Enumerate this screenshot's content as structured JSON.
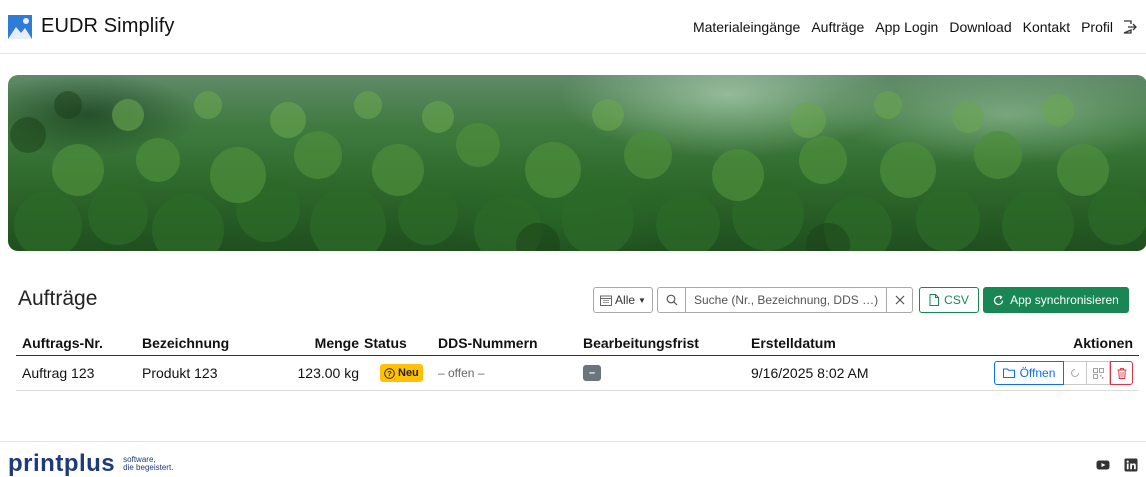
{
  "app": {
    "title": "EUDR Simplify"
  },
  "nav": {
    "items": [
      {
        "label": "Materialeingänge"
      },
      {
        "label": "Aufträge"
      },
      {
        "label": "App Login"
      },
      {
        "label": "Download"
      },
      {
        "label": "Kontakt"
      },
      {
        "label": "Profil"
      }
    ],
    "logout_icon": "logout-icon"
  },
  "section": {
    "title": "Aufträge"
  },
  "toolbar": {
    "filter_label": "Alle",
    "search_placeholder": "Suche (Nr., Bezeichnung, DDS …)",
    "csv_label": "CSV",
    "sync_label": "App synchronisieren"
  },
  "table": {
    "columns": [
      "Auftrags-Nr.",
      "Bezeichnung",
      "Menge",
      "Status",
      "DDS-Nummern",
      "Bearbeitungsfrist",
      "Erstelldatum",
      "Aktionen"
    ],
    "rows": [
      {
        "nr": "Auftrag 123",
        "bezeichnung": "Produkt 123",
        "menge": "123.00 kg",
        "status": "Neu",
        "dds": "– offen –",
        "frist": "–",
        "datum": "9/16/2025 8:02 AM",
        "open_label": "Öffnen"
      }
    ]
  },
  "footer": {
    "logo": "printplus",
    "tagline_1": "software,",
    "tagline_2": "die begeistert."
  },
  "colors": {
    "success": "#198754",
    "primary": "#0d6efd",
    "danger": "#dc3545",
    "warning": "#ffc107",
    "secondary": "#6c757d",
    "footer_brand": "#1d3b7c"
  }
}
